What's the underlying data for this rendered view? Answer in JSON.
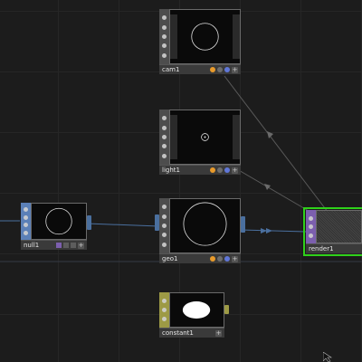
{
  "canvas": {
    "background": "#1c1c1c",
    "wire_color": "#4a6f9e",
    "selection_color": "#2fd11a"
  },
  "nodes": [
    {
      "id": "cam1",
      "label": "cam1",
      "family": "COMP",
      "side_color": "gray",
      "preview": "circle-outline"
    },
    {
      "id": "light1",
      "label": "light1",
      "family": "COMP",
      "side_color": "gray",
      "preview": "small-dot"
    },
    {
      "id": "null1",
      "label": "null1",
      "family": "SOP",
      "side_color": "blue",
      "preview": "circle-outline"
    },
    {
      "id": "geo1",
      "label": "geo1",
      "family": "COMP",
      "side_color": "gray",
      "preview": "circle-outline"
    },
    {
      "id": "render1",
      "label": "render1",
      "family": "TOP",
      "side_color": "purple",
      "preview": "noise",
      "selected": true
    },
    {
      "id": "constant1",
      "label": "constant1",
      "family": "TOP",
      "side_color": "olive",
      "preview": "white-ellipse"
    }
  ],
  "icons": {
    "side_buttons": [
      "viewer-icon",
      "bypass-icon",
      "lock-icon",
      "display-icon",
      "render-flag-icon"
    ],
    "cursor": "arrow-cursor-icon"
  }
}
